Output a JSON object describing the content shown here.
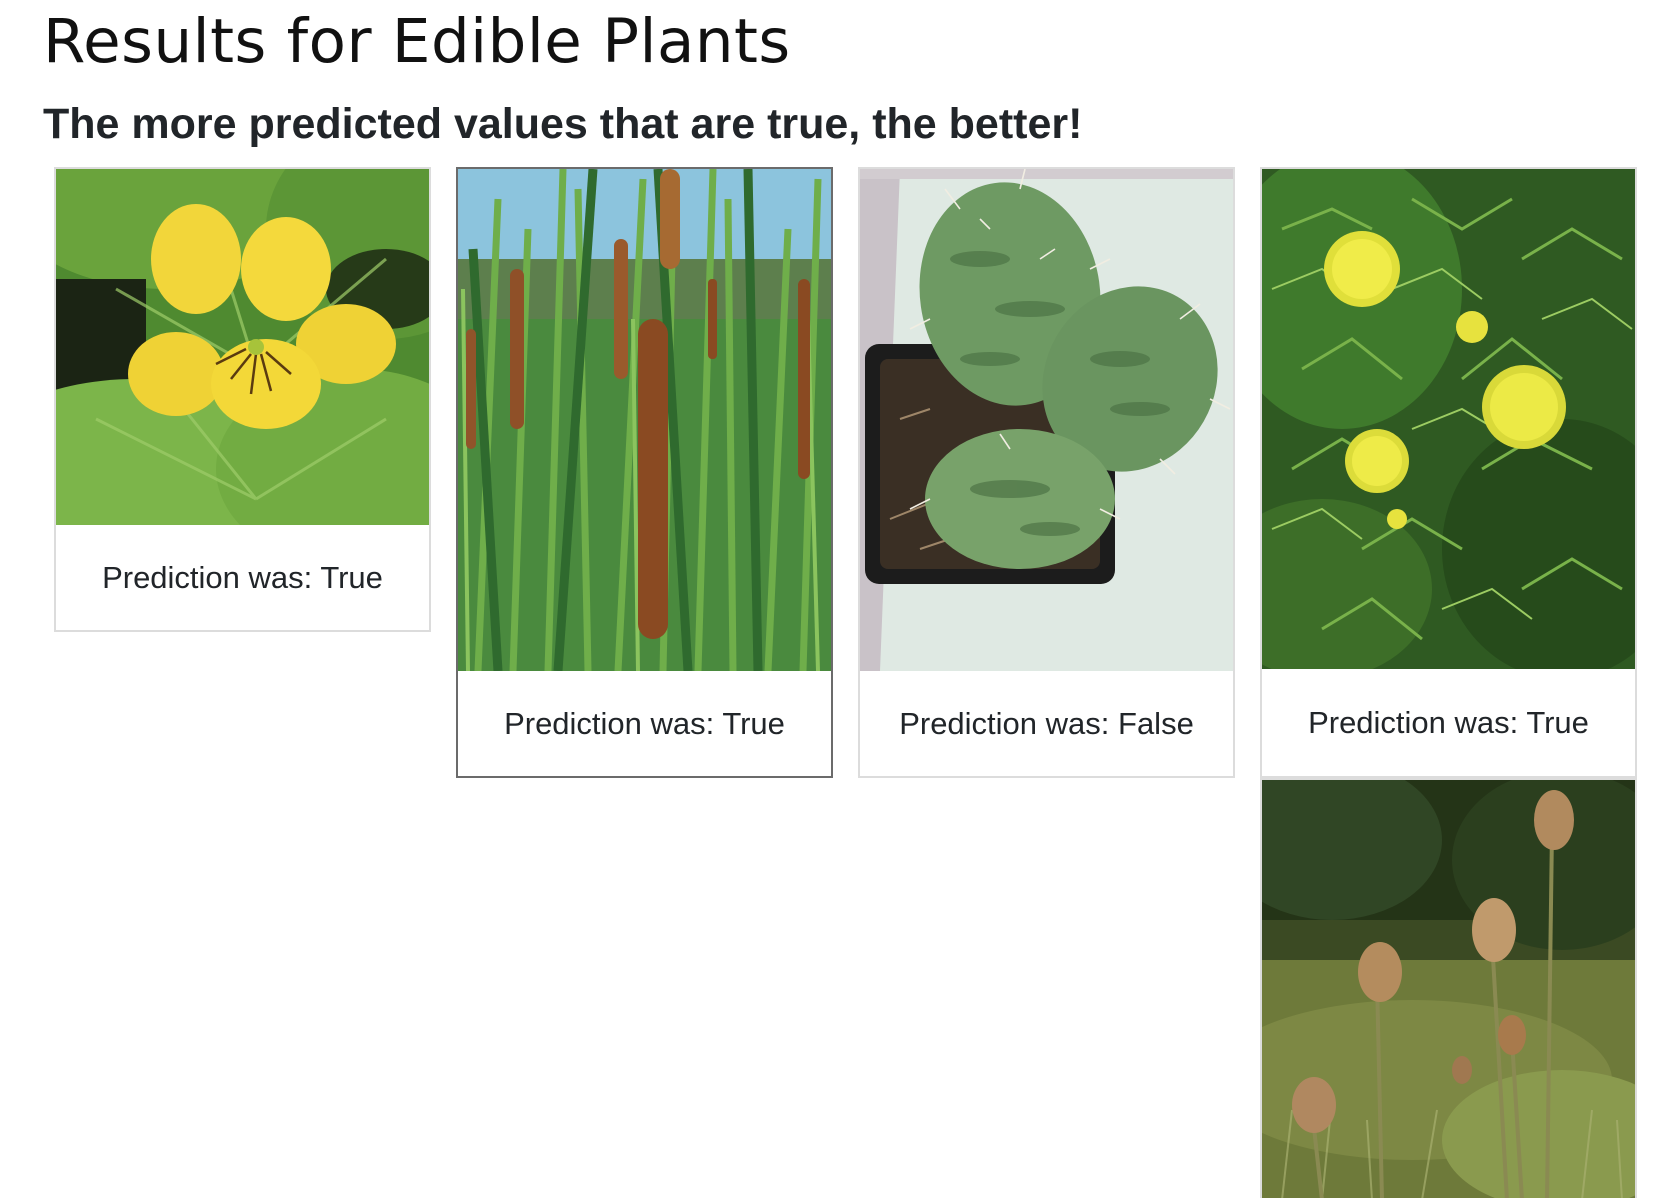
{
  "page": {
    "title": "Results for Edible Plants",
    "subtitle": "The more predicted values that are true, the better!"
  },
  "results": [
    {
      "image_icon": "yellow-violet-photo",
      "caption": "Prediction was: True"
    },
    {
      "image_icon": "cattail-photo",
      "caption": "Prediction was: True"
    },
    {
      "image_icon": "prickly-pear-cactus-photo",
      "caption": "Prediction was: False"
    },
    {
      "image_icon": "pineapple-weed-photo",
      "caption": "Prediction was: True"
    },
    {
      "image_icon": "teasel-photo",
      "caption": ""
    }
  ],
  "colors": {
    "title_text": "#111111",
    "subtitle_text": "#212529",
    "card_border": "#dcdcdc",
    "card_border_selected": "#6b6b6b"
  }
}
